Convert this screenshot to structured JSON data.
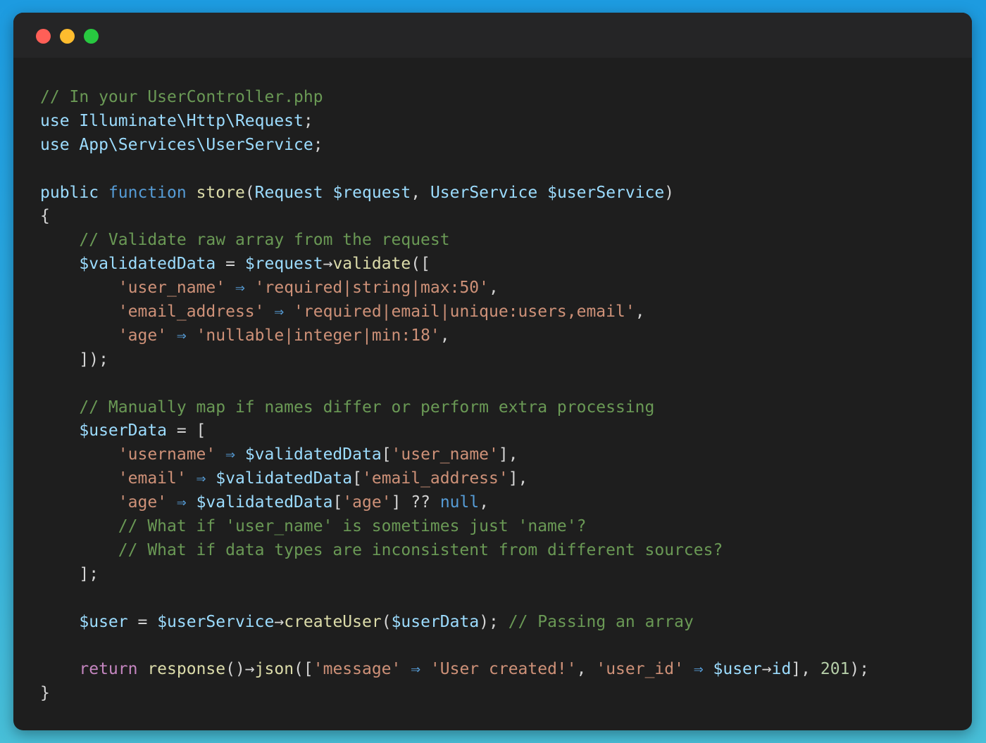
{
  "window": {
    "controls": [
      "close",
      "minimize",
      "maximize"
    ],
    "colors": {
      "close": "#ff5f57",
      "minimize": "#febc2e",
      "maximize": "#28c840",
      "background": "#1e1e1e"
    }
  },
  "code": {
    "language": "php",
    "lines": [
      [
        {
          "t": "// In your UserController.php",
          "k": "comment"
        }
      ],
      [
        {
          "t": "use ",
          "k": "namespace"
        },
        {
          "t": "Illuminate\\Http\\Request",
          "k": "namespace"
        },
        {
          "t": ";",
          "k": "punct"
        }
      ],
      [
        {
          "t": "use ",
          "k": "namespace"
        },
        {
          "t": "App\\Services\\UserService",
          "k": "namespace"
        },
        {
          "t": ";",
          "k": "punct"
        }
      ],
      [],
      [
        {
          "t": "public ",
          "k": "namespace"
        },
        {
          "t": "function ",
          "k": "keyword"
        },
        {
          "t": "store",
          "k": "func"
        },
        {
          "t": "(",
          "k": "punct"
        },
        {
          "t": "Request ",
          "k": "type"
        },
        {
          "t": "$request",
          "k": "var"
        },
        {
          "t": ", ",
          "k": "punct"
        },
        {
          "t": "UserService ",
          "k": "type"
        },
        {
          "t": "$userService",
          "k": "var"
        },
        {
          "t": ")",
          "k": "punct"
        }
      ],
      [
        {
          "t": "{",
          "k": "punct"
        }
      ],
      [
        {
          "t": "    // Validate raw array from the request",
          "k": "comment"
        }
      ],
      [
        {
          "t": "    ",
          "k": "punct"
        },
        {
          "t": "$validatedData",
          "k": "var"
        },
        {
          "t": " = ",
          "k": "punct"
        },
        {
          "t": "$request",
          "k": "var"
        },
        {
          "t": "→",
          "k": "punct"
        },
        {
          "t": "validate",
          "k": "func"
        },
        {
          "t": "([",
          "k": "punct"
        }
      ],
      [
        {
          "t": "        ",
          "k": "punct"
        },
        {
          "t": "'user_name'",
          "k": "string"
        },
        {
          "t": " ⇒ ",
          "k": "op"
        },
        {
          "t": "'required|string|max:50'",
          "k": "string"
        },
        {
          "t": ",",
          "k": "punct"
        }
      ],
      [
        {
          "t": "        ",
          "k": "punct"
        },
        {
          "t": "'email_address'",
          "k": "string"
        },
        {
          "t": " ⇒ ",
          "k": "op"
        },
        {
          "t": "'required|email|unique:users,email'",
          "k": "string"
        },
        {
          "t": ",",
          "k": "punct"
        }
      ],
      [
        {
          "t": "        ",
          "k": "punct"
        },
        {
          "t": "'age'",
          "k": "string"
        },
        {
          "t": " ⇒ ",
          "k": "op"
        },
        {
          "t": "'nullable|integer|min:18'",
          "k": "string"
        },
        {
          "t": ",",
          "k": "punct"
        }
      ],
      [
        {
          "t": "    ]);",
          "k": "punct"
        }
      ],
      [],
      [
        {
          "t": "    // Manually map if names differ or perform extra processing",
          "k": "comment"
        }
      ],
      [
        {
          "t": "    ",
          "k": "punct"
        },
        {
          "t": "$userData",
          "k": "var"
        },
        {
          "t": " = [",
          "k": "punct"
        }
      ],
      [
        {
          "t": "        ",
          "k": "punct"
        },
        {
          "t": "'username'",
          "k": "string"
        },
        {
          "t": " ⇒ ",
          "k": "op"
        },
        {
          "t": "$validatedData",
          "k": "var"
        },
        {
          "t": "[",
          "k": "punct"
        },
        {
          "t": "'user_name'",
          "k": "string"
        },
        {
          "t": "],",
          "k": "punct"
        }
      ],
      [
        {
          "t": "        ",
          "k": "punct"
        },
        {
          "t": "'email'",
          "k": "string"
        },
        {
          "t": " ⇒ ",
          "k": "op"
        },
        {
          "t": "$validatedData",
          "k": "var"
        },
        {
          "t": "[",
          "k": "punct"
        },
        {
          "t": "'email_address'",
          "k": "string"
        },
        {
          "t": "],",
          "k": "punct"
        }
      ],
      [
        {
          "t": "        ",
          "k": "punct"
        },
        {
          "t": "'age'",
          "k": "string"
        },
        {
          "t": " ⇒ ",
          "k": "op"
        },
        {
          "t": "$validatedData",
          "k": "var"
        },
        {
          "t": "[",
          "k": "punct"
        },
        {
          "t": "'age'",
          "k": "string"
        },
        {
          "t": "] ?? ",
          "k": "punct"
        },
        {
          "t": "null",
          "k": "keyword"
        },
        {
          "t": ",",
          "k": "punct"
        }
      ],
      [
        {
          "t": "        // What if 'user_name' is sometimes just 'name'?",
          "k": "comment"
        }
      ],
      [
        {
          "t": "        // What if data types are inconsistent from different sources?",
          "k": "comment"
        }
      ],
      [
        {
          "t": "    ];",
          "k": "punct"
        }
      ],
      [],
      [
        {
          "t": "    ",
          "k": "punct"
        },
        {
          "t": "$user",
          "k": "var"
        },
        {
          "t": " = ",
          "k": "punct"
        },
        {
          "t": "$userService",
          "k": "var"
        },
        {
          "t": "→",
          "k": "punct"
        },
        {
          "t": "createUser",
          "k": "func"
        },
        {
          "t": "(",
          "k": "punct"
        },
        {
          "t": "$userData",
          "k": "var"
        },
        {
          "t": "); ",
          "k": "punct"
        },
        {
          "t": "// Passing an array",
          "k": "comment"
        }
      ],
      [],
      [
        {
          "t": "    ",
          "k": "punct"
        },
        {
          "t": "return ",
          "k": "control"
        },
        {
          "t": "response",
          "k": "func"
        },
        {
          "t": "()→",
          "k": "punct"
        },
        {
          "t": "json",
          "k": "func"
        },
        {
          "t": "([",
          "k": "punct"
        },
        {
          "t": "'message'",
          "k": "string"
        },
        {
          "t": " ⇒ ",
          "k": "op"
        },
        {
          "t": "'User created!'",
          "k": "string"
        },
        {
          "t": ", ",
          "k": "punct"
        },
        {
          "t": "'user_id'",
          "k": "string"
        },
        {
          "t": " ⇒ ",
          "k": "op"
        },
        {
          "t": "$user",
          "k": "var"
        },
        {
          "t": "→",
          "k": "punct"
        },
        {
          "t": "id",
          "k": "var"
        },
        {
          "t": "], ",
          "k": "punct"
        },
        {
          "t": "201",
          "k": "number"
        },
        {
          "t": ");",
          "k": "punct"
        }
      ],
      [
        {
          "t": "}",
          "k": "punct"
        }
      ]
    ]
  }
}
